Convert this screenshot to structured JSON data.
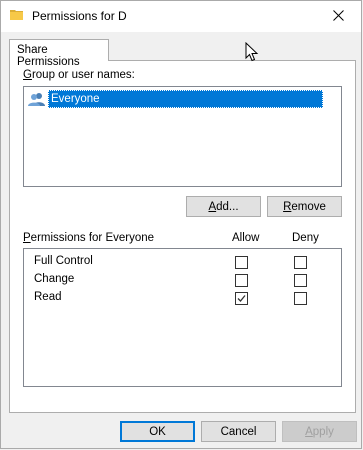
{
  "window": {
    "title": "Permissions for D"
  },
  "tabs": [
    {
      "label": "Share Permissions"
    }
  ],
  "group_section": {
    "label_prefix": "",
    "label_mnemonic": "G",
    "label_rest": "roup or user names:",
    "items": [
      {
        "name": "Everyone",
        "selected": true
      }
    ]
  },
  "buttons": {
    "add_mnemonic": "A",
    "add_rest": "dd...",
    "remove_mnemonic": "R",
    "remove_rest": "emove",
    "ok": "OK",
    "cancel": "Cancel",
    "apply_mnemonic": "A",
    "apply_rest": "pply"
  },
  "permissions": {
    "label_mnemonic": "P",
    "label_rest": "ermissions for Everyone",
    "allow_header": "Allow",
    "deny_header": "Deny",
    "rows": [
      {
        "name": "Full Control",
        "allow": false,
        "deny": false
      },
      {
        "name": "Change",
        "allow": false,
        "deny": false
      },
      {
        "name": "Read",
        "allow": true,
        "deny": false
      }
    ]
  },
  "icons": {
    "folder": "folder-icon",
    "close": "close-icon",
    "users": "users-icon",
    "cursor": "mouse-cursor-icon"
  },
  "colors": {
    "selection": "#0078d7",
    "folder": "#f7c948",
    "button_face": "#e1e1e1"
  }
}
